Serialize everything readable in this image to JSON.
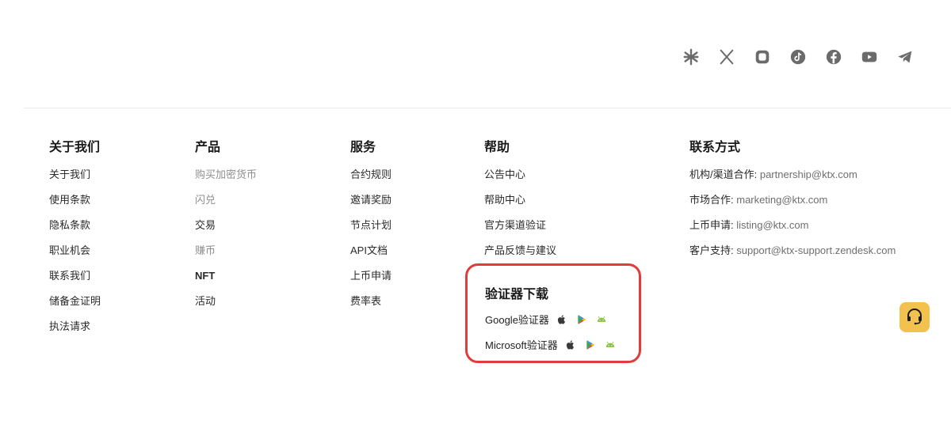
{
  "colors": {
    "accent": "#f2c14e",
    "highlight_border": "#e23b3b",
    "link_muted": "#8f8f8f"
  },
  "social_icons": [
    "linktree-icon",
    "x-icon",
    "instagram-icon",
    "tiktok-icon",
    "facebook-icon",
    "youtube-icon",
    "telegram-icon"
  ],
  "columns": {
    "about": {
      "title": "关于我们",
      "items": [
        "关于我们",
        "使用条款",
        "隐私条款",
        "职业机会",
        "联系我们",
        "储备金证明",
        "执法请求"
      ]
    },
    "products": {
      "title": "产品",
      "items": [
        "购买加密货币",
        "闪兑",
        "交易",
        "赚币",
        "NFT",
        "活动"
      ]
    },
    "services": {
      "title": "服务",
      "items": [
        "合约规则",
        "邀请奖励",
        "节点计划",
        "API文档",
        "上币申请",
        "费率表"
      ]
    },
    "help": {
      "title": "帮助",
      "items": [
        "公告中心",
        "帮助中心",
        "官方渠道验证",
        "产品反馈与建议"
      ]
    },
    "contact": {
      "title": "联系方式",
      "items": [
        {
          "label": "机构/渠道合作: ",
          "value": "partnership@ktx.com"
        },
        {
          "label": "市场合作: ",
          "value": "marketing@ktx.com"
        },
        {
          "label": "上币申请: ",
          "value": "listing@ktx.com"
        },
        {
          "label": "客户支持: ",
          "value": "support@ktx-support.zendesk.com"
        }
      ]
    }
  },
  "authenticator": {
    "title": "验证器下载",
    "rows": [
      {
        "name": "Google验证器",
        "icons": [
          "apple-icon",
          "google-play-icon",
          "android-icon"
        ]
      },
      {
        "name": "Microsoft验证器",
        "icons": [
          "apple-icon",
          "google-play-icon",
          "android-icon"
        ]
      }
    ]
  },
  "support_button_icon": "headset-icon"
}
